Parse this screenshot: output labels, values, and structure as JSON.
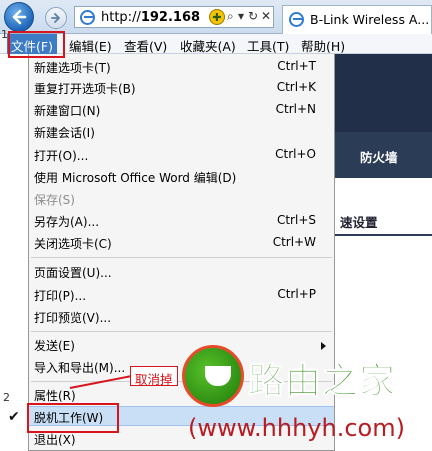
{
  "toolbar": {
    "address_prefix": "http://",
    "address_host": "192.168",
    "search_glyph": "⌕",
    "dropdown_glyph": "▾",
    "refresh_glyph": "↻",
    "stop_glyph": "✕",
    "compat_glyph": "✚"
  },
  "tab": {
    "title": "B-Link Wireless A..."
  },
  "menubar": {
    "items": [
      {
        "label": "文件(F)"
      },
      {
        "label": "编辑(E)"
      },
      {
        "label": "查看(V)"
      },
      {
        "label": "收藏夹(A)"
      },
      {
        "label": "工具(T)"
      },
      {
        "label": "帮助(H)"
      }
    ]
  },
  "file_menu": {
    "items": [
      {
        "label": "新建选项卡(T)",
        "shortcut": "Ctrl+T"
      },
      {
        "label": "重复打开选项卡(B)",
        "shortcut": "Ctrl+K"
      },
      {
        "label": "新建窗口(N)",
        "shortcut": "Ctrl+N"
      },
      {
        "label": "新建会话(I)",
        "shortcut": ""
      },
      {
        "label": "打开(O)...",
        "shortcut": "Ctrl+O"
      },
      {
        "label": "使用 Microsoft Office Word 编辑(D)",
        "shortcut": ""
      },
      {
        "label": "保存(S)",
        "shortcut": ""
      },
      {
        "label": "另存为(A)...",
        "shortcut": "Ctrl+S"
      },
      {
        "label": "关闭选项卡(C)",
        "shortcut": "Ctrl+W"
      },
      {
        "label": "页面设置(U)...",
        "shortcut": ""
      },
      {
        "label": "打印(P)...",
        "shortcut": "Ctrl+P"
      },
      {
        "label": "打印预览(V)...",
        "shortcut": ""
      },
      {
        "label": "发送(E)",
        "shortcut": ""
      },
      {
        "label": "导入和导出(M)...",
        "shortcut": ""
      },
      {
        "label": "属性(R)",
        "shortcut": ""
      },
      {
        "label": "脱机工作(W)",
        "shortcut": ""
      },
      {
        "label": "退出(X)",
        "shortcut": ""
      }
    ]
  },
  "page": {
    "nav_label": "防火墙",
    "quick_setup": "速设置"
  },
  "annotations": {
    "step1": "1",
    "step2": "2",
    "callout": "取消掉",
    "check_glyph": "✔"
  },
  "watermark": {
    "title": "路由之家",
    "url": "(www.hhhyh.com)"
  },
  "colors": {
    "menu_highlight": "#c9dff5",
    "annotation_red": "#d6161c",
    "file_menu_active": "#3d7bc4",
    "watermark_green": "#2f8f1a"
  }
}
